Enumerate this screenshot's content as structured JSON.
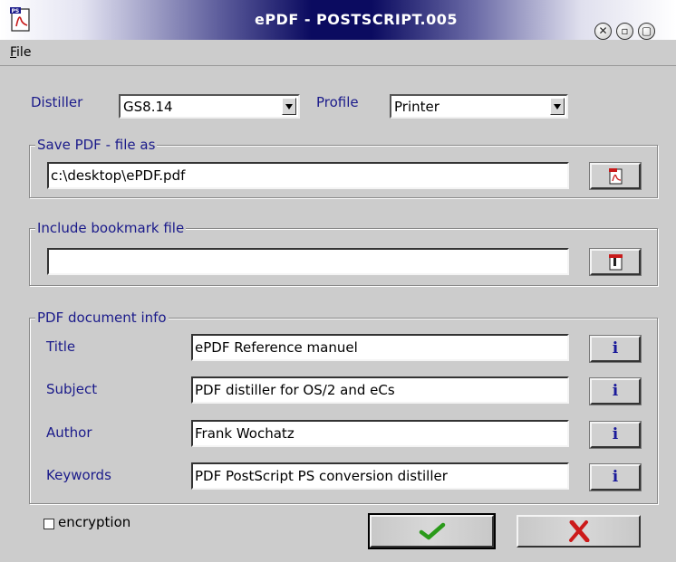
{
  "window": {
    "title": "ePDF - POSTSCRIPT.005"
  },
  "icons": {
    "app": "pdf-document-icon",
    "close": "close-icon",
    "minimize": "minimize-icon",
    "maximize": "maximize-icon",
    "save_browse": "pdf-file-browse-icon",
    "bookmark_browse": "bookmark-file-browse-icon",
    "info": "info-icon",
    "ok": "checkmark-icon",
    "cancel": "x-icon"
  },
  "menubar": {
    "file_mnemonic": "F",
    "file_rest": "ile"
  },
  "distiller": {
    "label": "Distiller",
    "value": "GS8.14"
  },
  "profile": {
    "label": "Profile",
    "value": "Printer"
  },
  "save_group": {
    "title": "Save PDF - file as",
    "value": "c:\\desktop\\ePDF.pdf"
  },
  "bookmark_group": {
    "title": "Include bookmark file",
    "value": ""
  },
  "info_group": {
    "title": "PDF document info",
    "info_glyph": "i",
    "fields": [
      {
        "label": "Title",
        "value": "ePDF Reference manuel"
      },
      {
        "label": "Subject",
        "value": "PDF distiller for OS/2 and eCs"
      },
      {
        "label": "Author",
        "value": "Frank Wochatz"
      },
      {
        "label": "Keywords",
        "value": "PDF PostScript PS conversion distiller"
      }
    ]
  },
  "encryption": {
    "label": "encryption",
    "checked": false
  },
  "colors": {
    "label_blue": "#1a1a8a",
    "ok_green": "#2a9a1a",
    "cancel_red": "#cc1a1a",
    "title_navy": "#0b0b60"
  }
}
